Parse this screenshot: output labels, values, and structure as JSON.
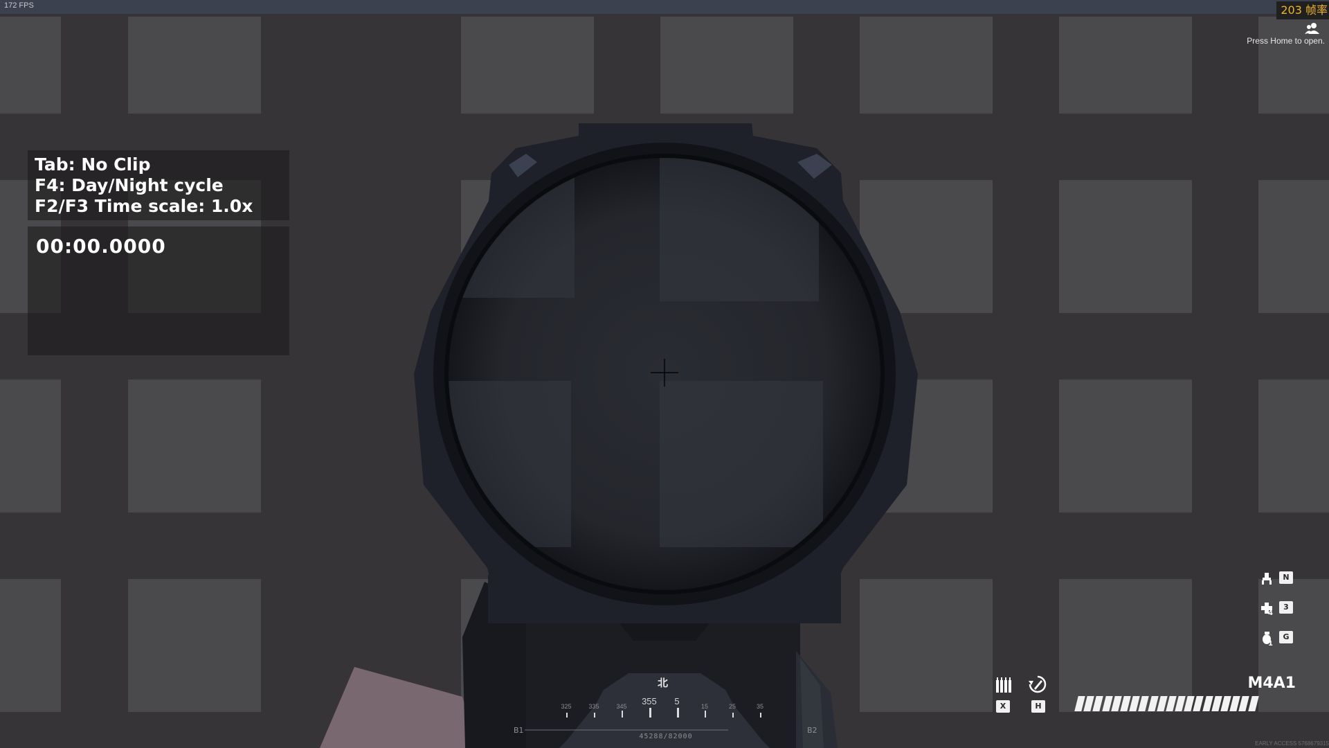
{
  "hud_top": {
    "fps_small": "172 FPS",
    "fps_overlay": "203 帧率",
    "press_home": "Press Home to open."
  },
  "help": {
    "lines": [
      "Tab: No Clip",
      "F4: Day/Night cycle",
      "F2/F3 Time scale: 1.0x"
    ]
  },
  "timer": {
    "value": "00:00.0000"
  },
  "compass": {
    "north_label": "北",
    "ticks": [
      {
        "label": "325",
        "kind": "minor"
      },
      {
        "label": "335",
        "kind": "minor"
      },
      {
        "label": "345",
        "kind": "mid"
      },
      {
        "label": "355",
        "kind": "major"
      },
      {
        "label": "5",
        "kind": "major"
      },
      {
        "label": "15",
        "kind": "mid"
      },
      {
        "label": "25",
        "kind": "minor"
      },
      {
        "label": "35",
        "kind": "minor"
      }
    ],
    "left_marker": "B1",
    "right_marker": "B2",
    "readout": "45288/82000"
  },
  "weapon": {
    "name": "M4A1",
    "rounds_loaded": 20,
    "magazines_key": "X",
    "fire_mode_key": "H"
  },
  "equipment": [
    {
      "icon": "bipod-icon",
      "key": "N",
      "count": ""
    },
    {
      "icon": "medkit-icon",
      "key": "3",
      "count": "4"
    },
    {
      "icon": "grenade-icon",
      "key": "G",
      "count": "1"
    }
  ],
  "footer": {
    "build": "EARLY ACCESS 5768679315"
  },
  "colors": {
    "background": "#363437",
    "wall_tile": "#4a494b",
    "fps_overlay": "#f0b428",
    "scope_body": "#1e2129"
  }
}
